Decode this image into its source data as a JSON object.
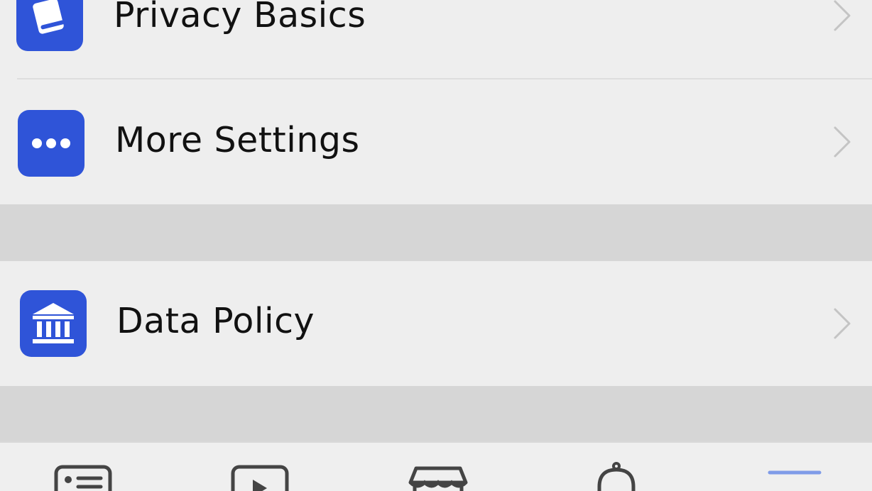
{
  "colors": {
    "icon_background": "#2f54d8",
    "section_gap": "#d6d6d6",
    "row_background": "#eeeeee",
    "active_tab_indicator": "#7f9be8"
  },
  "settings_rows": [
    {
      "label": "Privacy Basics",
      "icon": "book-icon"
    },
    {
      "label": "More Settings",
      "icon": "ellipsis-icon"
    },
    {
      "label": "Data Policy",
      "icon": "bank-icon"
    }
  ],
  "tab_bar": {
    "tabs": [
      {
        "icon": "news-feed-icon",
        "active": false
      },
      {
        "icon": "video-icon",
        "active": false
      },
      {
        "icon": "marketplace-icon",
        "active": false
      },
      {
        "icon": "notifications-bell-icon",
        "active": false
      },
      {
        "icon": "menu-icon",
        "active": true
      }
    ]
  }
}
